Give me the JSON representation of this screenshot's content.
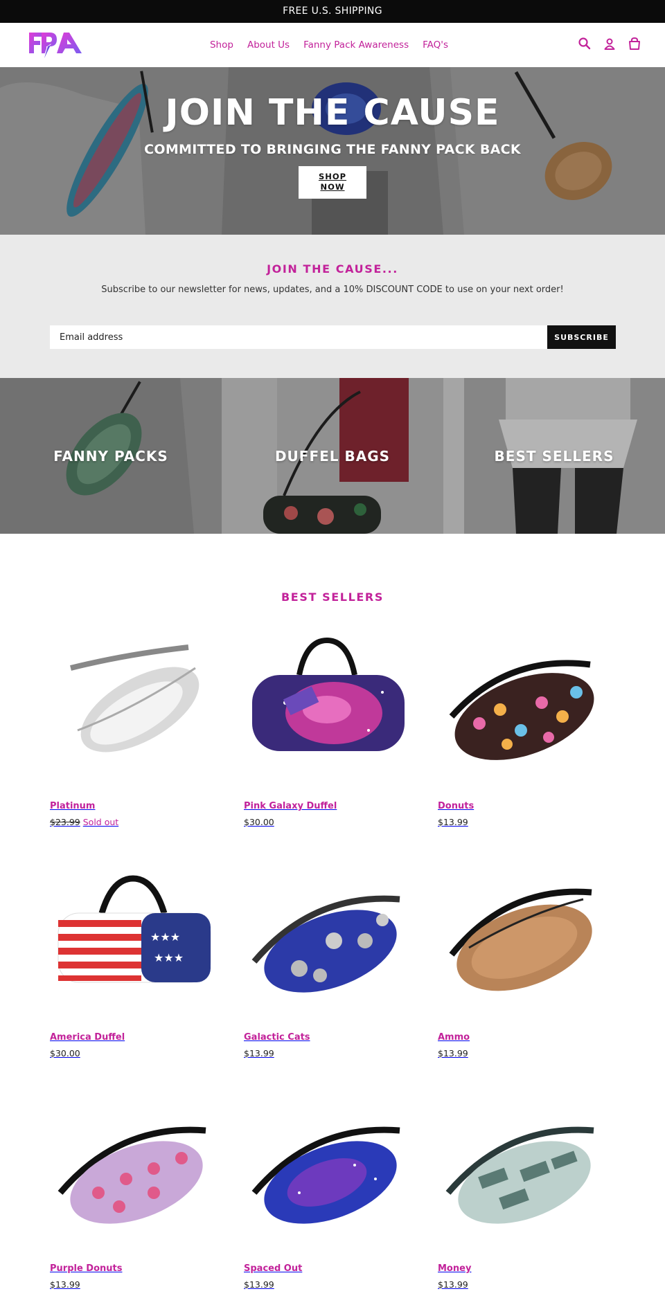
{
  "announcement": "FREE U.S. SHIPPING",
  "logo_text": "FPA",
  "nav": [
    "Shop",
    "About Us",
    "Fanny Pack Awareness",
    "FAQ's"
  ],
  "header_icons": [
    "search-icon",
    "account-icon",
    "cart-icon"
  ],
  "hero": {
    "title": "JOIN THE CAUSE",
    "subtitle": "COMMITTED TO BRINGING THE FANNY PACK BACK",
    "button": "SHOP\nNOW"
  },
  "newsletter": {
    "heading": "JOIN THE CAUSE...",
    "text": "Subscribe to our newsletter for news, updates, and a 10% DISCOUNT CODE to use on your next order!",
    "placeholder": "Email address",
    "button": "SUBSCRIBE"
  },
  "collections": [
    "FANNY PACKS",
    "DUFFEL BAGS",
    "BEST SELLERS"
  ],
  "bestsellers_heading": "BEST SELLERS",
  "products": [
    {
      "name": "Platinum",
      "price": "$23.99",
      "status": "Sold out"
    },
    {
      "name": "Pink Galaxy Duffel",
      "price": "$30.00",
      "status": ""
    },
    {
      "name": "Donuts",
      "price": "$13.99",
      "status": ""
    },
    {
      "name": "America Duffel",
      "price": "$30.00",
      "status": ""
    },
    {
      "name": "Galactic Cats",
      "price": "$13.99",
      "status": ""
    },
    {
      "name": "Ammo",
      "price": "$13.99",
      "status": ""
    },
    {
      "name": "Purple Donuts",
      "price": "$13.99",
      "status": ""
    },
    {
      "name": "Spaced Out",
      "price": "$13.99",
      "status": ""
    },
    {
      "name": "Money",
      "price": "$13.99",
      "status": ""
    }
  ],
  "colors": {
    "accent": "#c2229a",
    "announcement_bg": "#0b0b0b",
    "newsletter_bg": "#eaeaea",
    "button_dark": "#111111"
  }
}
